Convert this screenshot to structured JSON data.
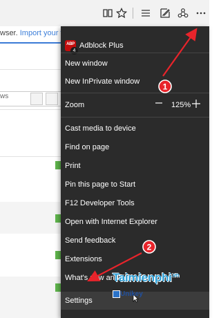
{
  "toolbar": {
    "icons": [
      "reading-view-icon",
      "favorite-star-icon",
      "hub-icon",
      "web-note-icon",
      "share-icon",
      "more-actions-icon"
    ]
  },
  "background_page": {
    "notice_prefix": "wser.",
    "notice_link": "Import your fav",
    "search_text": "ws"
  },
  "menu": {
    "extension": {
      "name": "Adblock Plus",
      "badge_text": "ABP",
      "count": "4"
    },
    "items": {
      "new_window": "New window",
      "new_inprivate": "New InPrivate window",
      "zoom_label": "Zoom",
      "zoom_value": "125%",
      "cast": "Cast media to device",
      "find": "Find on page",
      "print": "Print",
      "pin": "Pin this page to Start",
      "devtools": "F12 Developer Tools",
      "open_ie": "Open with Internet Explorer",
      "feedback": "Send feedback",
      "extensions": "Extensions",
      "whats_new": "What's new and tips",
      "settings": "Settings"
    }
  },
  "annotations": {
    "step1": "1",
    "step2": "2",
    "watermark": "Taimienphi",
    "watermark_suffix": ".vn",
    "unikey": "Unikey",
    "arrow_color": "#e8242b"
  }
}
